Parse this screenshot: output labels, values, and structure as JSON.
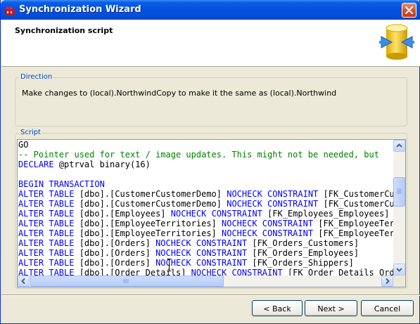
{
  "window": {
    "title": "Synchronization Wizard"
  },
  "header": {
    "title": "Synchronization script",
    "icon": "sync-database-icon"
  },
  "direction": {
    "legend": "Direction",
    "text": "Make changes to (local).NorthwindCopy to make it the same as (local).Northwind"
  },
  "script": {
    "legend": "Script",
    "lines": [
      [
        {
          "t": "tx",
          "v": "GO"
        }
      ],
      [
        {
          "t": "cm",
          "v": "-- Pointer used for text / image updates. This might not be needed, but"
        }
      ],
      [
        {
          "t": "kw",
          "v": "DECLARE"
        },
        {
          "t": "tx",
          "v": " @ptrval binary(16)"
        }
      ],
      [
        {
          "t": "tx",
          "v": ""
        }
      ],
      [
        {
          "t": "kw",
          "v": "BEGIN TRANSACTION"
        }
      ],
      [
        {
          "t": "kw",
          "v": "ALTER TABLE"
        },
        {
          "t": "tx",
          "v": " [dbo].[CustomerCustomerDemo] "
        },
        {
          "t": "kw",
          "v": "NOCHECK CONSTRAINT"
        },
        {
          "t": "tx",
          "v": " [FK_CustomerCustomerDemo]"
        }
      ],
      [
        {
          "t": "kw",
          "v": "ALTER TABLE"
        },
        {
          "t": "tx",
          "v": " [dbo].[CustomerCustomerDemo] "
        },
        {
          "t": "kw",
          "v": "NOCHECK CONSTRAINT"
        },
        {
          "t": "tx",
          "v": " [FK_CustomerCustomerDemo]"
        }
      ],
      [
        {
          "t": "kw",
          "v": "ALTER TABLE"
        },
        {
          "t": "tx",
          "v": " [dbo].[Employees] "
        },
        {
          "t": "kw",
          "v": "NOCHECK CONSTRAINT"
        },
        {
          "t": "tx",
          "v": " [FK_Employees_Employees]"
        }
      ],
      [
        {
          "t": "kw",
          "v": "ALTER TABLE"
        },
        {
          "t": "tx",
          "v": " [dbo].[EmployeeTerritories] "
        },
        {
          "t": "kw",
          "v": "NOCHECK CONSTRAINT"
        },
        {
          "t": "tx",
          "v": " [FK_EmployeeTerritories]"
        }
      ],
      [
        {
          "t": "kw",
          "v": "ALTER TABLE"
        },
        {
          "t": "tx",
          "v": " [dbo].[EmployeeTerritories] "
        },
        {
          "t": "kw",
          "v": "NOCHECK CONSTRAINT"
        },
        {
          "t": "tx",
          "v": " [FK_EmployeeTerritories]"
        }
      ],
      [
        {
          "t": "kw",
          "v": "ALTER TABLE"
        },
        {
          "t": "tx",
          "v": " [dbo].[Orders] "
        },
        {
          "t": "kw",
          "v": "NOCHECK CONSTRAINT"
        },
        {
          "t": "tx",
          "v": " [FK_Orders_Customers]"
        }
      ],
      [
        {
          "t": "kw",
          "v": "ALTER TABLE"
        },
        {
          "t": "tx",
          "v": " [dbo].[Orders] "
        },
        {
          "t": "kw",
          "v": "NOCHECK CONSTRAINT"
        },
        {
          "t": "tx",
          "v": " [FK_Orders_Employees]"
        }
      ],
      [
        {
          "t": "kw",
          "v": "ALTER TABLE"
        },
        {
          "t": "tx",
          "v": " [dbo].[Orders] "
        },
        {
          "t": "kw",
          "v": "NOCHECK CONSTRAINT"
        },
        {
          "t": "tx",
          "v": " [FK_Orders_Shippers]"
        }
      ],
      [
        {
          "t": "kw",
          "v": "ALTER TABLE"
        },
        {
          "t": "tx",
          "v": " [dbo].[Order Details] "
        },
        {
          "t": "kw",
          "v": "NOCHECK CONSTRAINT"
        },
        {
          "t": "tx",
          "v": " [FK_Order_Details_Orders]"
        }
      ]
    ]
  },
  "buttons": {
    "back": "< Back",
    "next": "Next >",
    "cancel": "Cancel"
  },
  "colors": {
    "keyword": "#0000ff",
    "comment": "#008000",
    "legend": "#0046d5"
  }
}
